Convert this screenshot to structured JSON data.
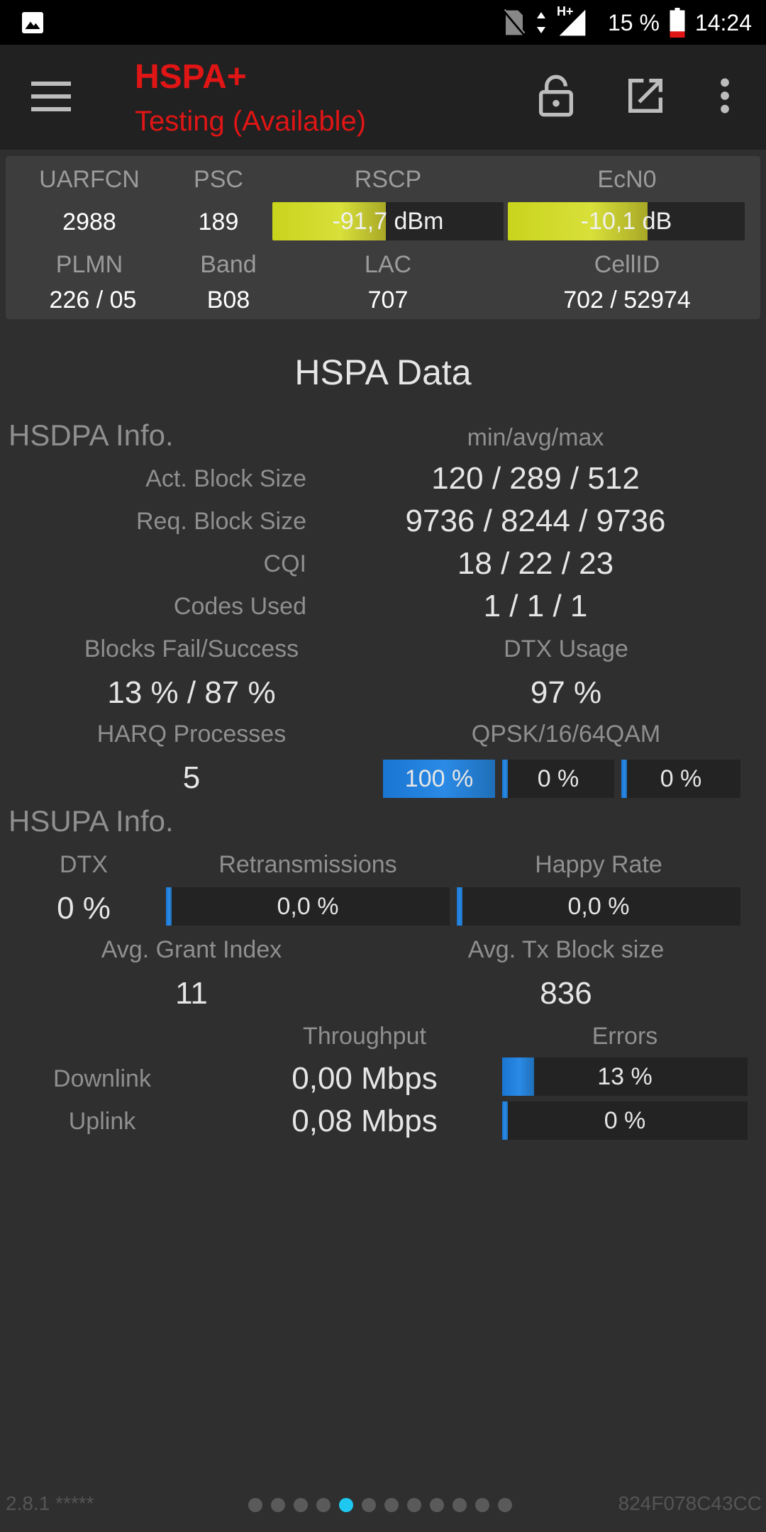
{
  "status_bar": {
    "icons": [
      "image-notification-icon",
      "no-sim-icon",
      "data-arrows-icon",
      "signal-icon",
      "battery-icon"
    ],
    "network_type": "H+",
    "battery": "15 %",
    "time": "14:24"
  },
  "app_bar": {
    "title": "HSPA+",
    "subtitle": "Testing (Available)",
    "accent_color": "#e01515"
  },
  "cell": {
    "uarfcn_label": "UARFCN",
    "uarfcn": "2988",
    "psc_label": "PSC",
    "psc": "189",
    "rscp_label": "RSCP",
    "rscp": "-91,7 dBm",
    "rscp_level": 0.49,
    "ecn0_label": "EcN0",
    "ecn0": "-10,1 dB",
    "ecn0_level": 0.59,
    "plmn_label": "PLMN",
    "plmn": "226 / 05",
    "band_label": "Band",
    "band": "B08",
    "lac_label": "LAC",
    "lac": "707",
    "cellid_label": "CellID",
    "cellid": "702 / 52974"
  },
  "hspa": {
    "title": "HSPA Data",
    "hsdpa_header": "HSDPA Info.",
    "minavgmax_label": "min/avg/max",
    "act_block_label": "Act. Block Size",
    "act_block": "120 / 289 / 512",
    "req_block_label": "Req. Block Size",
    "req_block": "9736 / 8244 / 9736",
    "cqi_label": "CQI",
    "cqi": "18 / 22 / 23",
    "codes_label": "Codes Used",
    "codes": "1 / 1 / 1",
    "blocks_label": "Blocks Fail/Success",
    "blocks": "13 % / 87 %",
    "dtx_usage_label": "DTX Usage",
    "dtx_usage": "97 %",
    "harq_label": "HARQ Processes",
    "harq": "5",
    "qam_label": "QPSK/16/64QAM",
    "qpsk": "100 %",
    "qpsk_level": 1.0,
    "qam16": "0 %",
    "qam16_level": 0.0,
    "qam64": "0 %",
    "qam64_level": 0.0,
    "hsupa_header": "HSUPA Info.",
    "dtx_label": "DTX",
    "dtx": "0 %",
    "retrans_label": "Retransmissions",
    "retrans": "0,0 %",
    "retrans_level": 0.0,
    "happy_label": "Happy Rate",
    "happy": "0,0 %",
    "happy_level": 0.0,
    "grant_label": "Avg. Grant Index",
    "grant": "11",
    "txblock_label": "Avg. Tx Block size",
    "txblock": "836",
    "throughput_label": "Throughput",
    "errors_label": "Errors",
    "downlink_label": "Downlink",
    "downlink": "0,00 Mbps",
    "downlink_errors": "13 %",
    "downlink_errors_level": 0.13,
    "uplink_label": "Uplink",
    "uplink": "0,08 Mbps",
    "uplink_errors": "0 %",
    "uplink_errors_level": 0.0
  },
  "footer": {
    "version": "2.8.1 *****",
    "device_id": "824F078C43CC",
    "page_count": 12,
    "active_page": 5
  }
}
